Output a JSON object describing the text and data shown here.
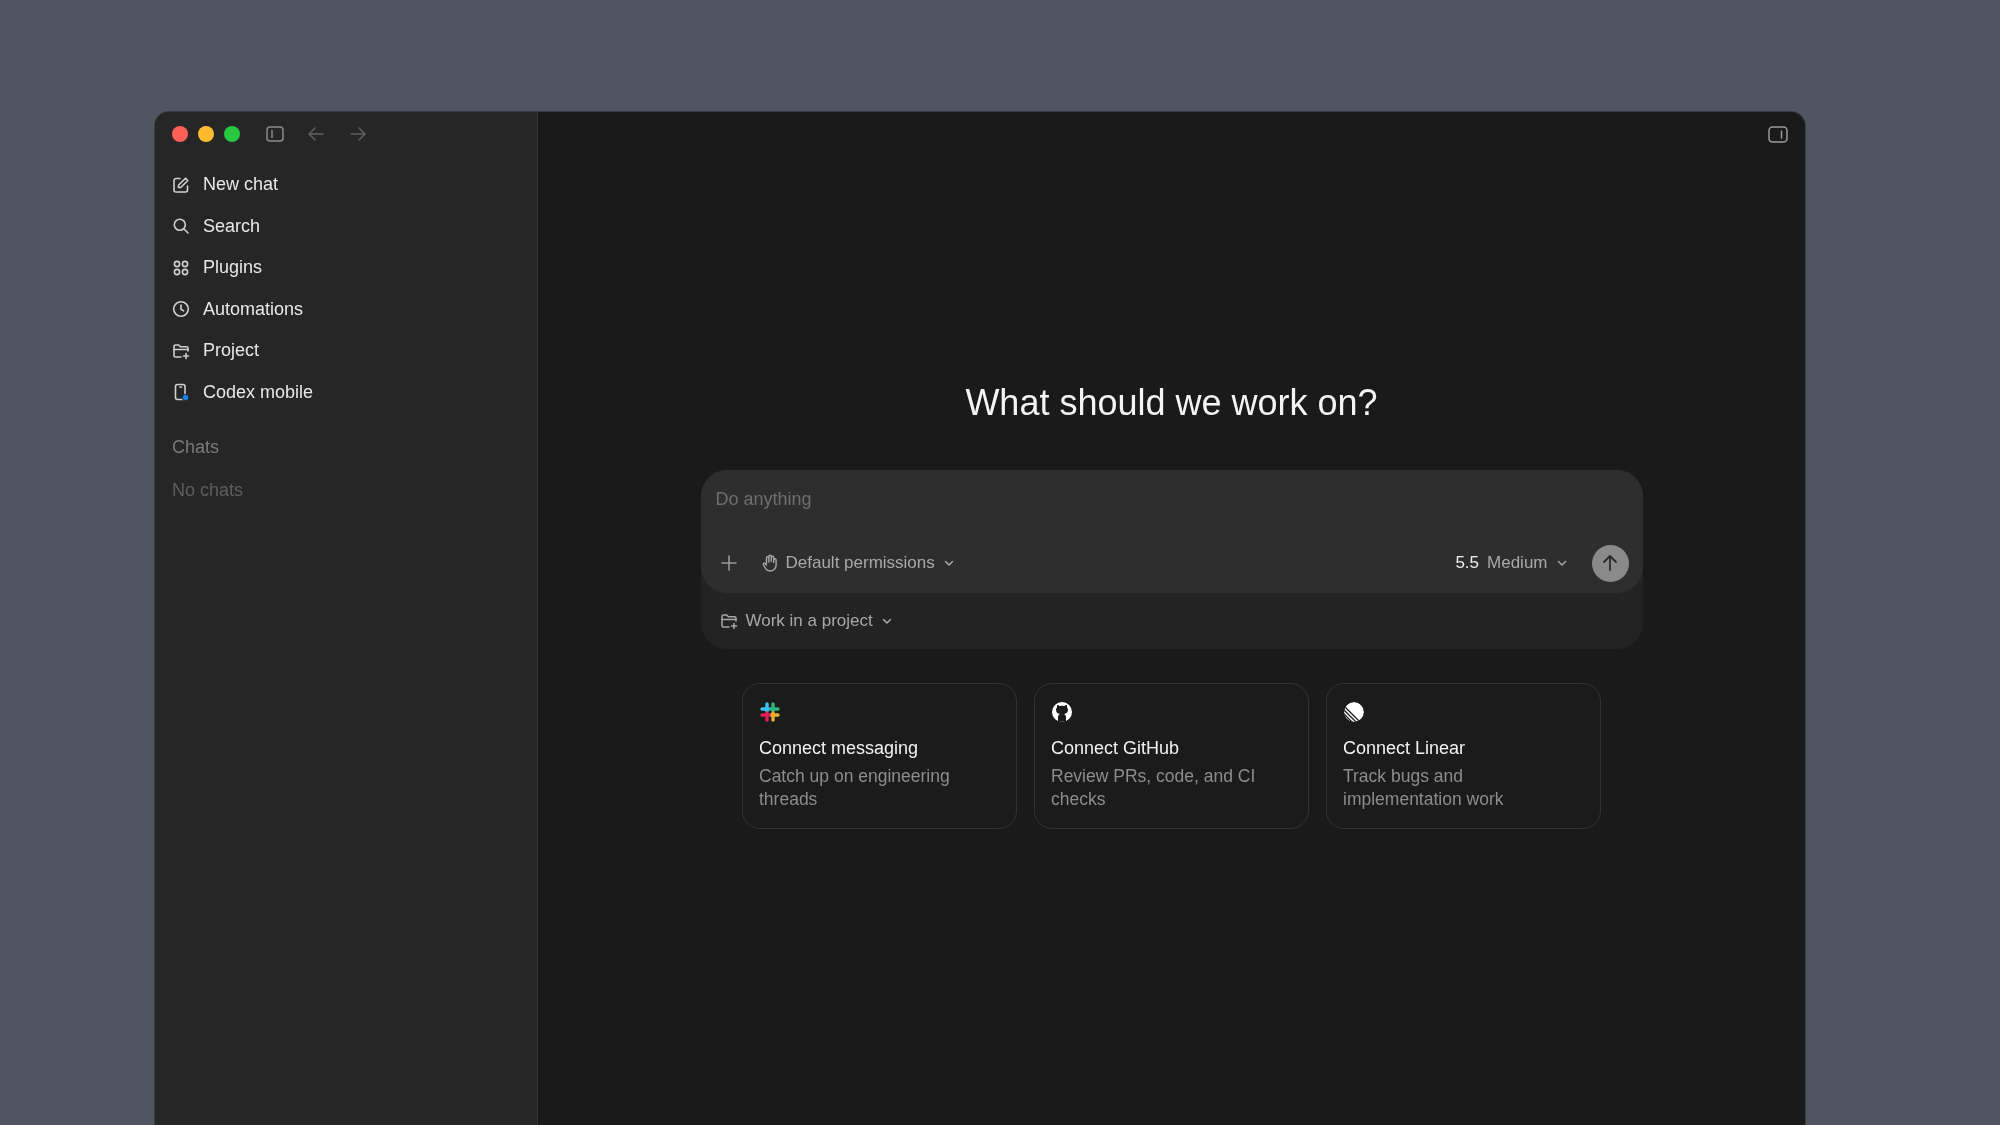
{
  "sidebar": {
    "items": [
      {
        "kind": "edit",
        "label": "New chat"
      },
      {
        "kind": "search",
        "label": "Search"
      },
      {
        "kind": "plugins",
        "label": "Plugins"
      },
      {
        "kind": "clock",
        "label": "Automations"
      },
      {
        "kind": "project",
        "label": "Project"
      },
      {
        "kind": "mobile",
        "label": "Codex mobile"
      }
    ],
    "section_title": "Chats",
    "empty_text": "No chats"
  },
  "heading": "What should we work on?",
  "composer": {
    "placeholder": "Do anything",
    "permissions": "Default permissions",
    "model": "5.5",
    "effort": "Medium",
    "project": "Work in a project"
  },
  "cards": [
    {
      "kind": "messaging",
      "title": "Connect messaging",
      "description": "Catch up on engineering threads"
    },
    {
      "kind": "github",
      "title": "Connect GitHub",
      "description": "Review PRs, code, and CI checks"
    },
    {
      "kind": "linear",
      "title": "Connect Linear",
      "description": "Track bugs and implementation work"
    }
  ]
}
